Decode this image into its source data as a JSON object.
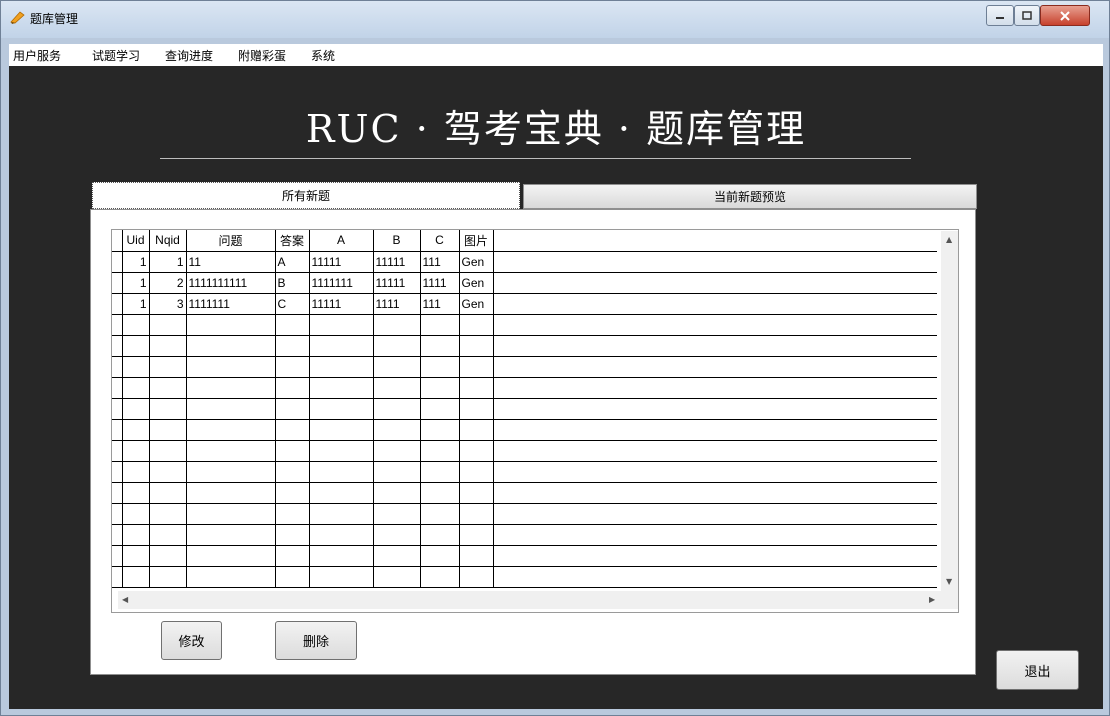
{
  "window": {
    "title": "题库管理",
    "icon": "app-pencil-icon"
  },
  "menu": {
    "items": [
      "用户服务",
      "试题学习",
      "查询进度",
      "附赠彩蛋",
      "系统"
    ]
  },
  "header": {
    "title": "RUC · 驾考宝典 · 题库管理"
  },
  "tabs": [
    {
      "label": "所有新题",
      "active": true
    },
    {
      "label": "当前新题预览",
      "active": false
    }
  ],
  "table": {
    "columns": [
      "Uid",
      "Nqid",
      "问题",
      "答案",
      "A",
      "B",
      "C",
      "图片"
    ],
    "rows": [
      [
        "1",
        "1",
        "11",
        "A",
        "11111",
        "11111",
        "111",
        "Gen"
      ],
      [
        "1",
        "2",
        "1111111111",
        "B",
        "1111111",
        "11111",
        "1111",
        "Gen"
      ],
      [
        "1",
        "3",
        "1111111",
        "C",
        "11111",
        "1111",
        "111",
        "Gen"
      ]
    ],
    "empty_rows": 13
  },
  "buttons": {
    "modify": "修改",
    "delete": "删除",
    "exit": "退出"
  },
  "colors": {
    "background": "#272727",
    "title_text": "#ffffff",
    "titlebar": "#c1d3e8",
    "close_button": "#c7422d"
  }
}
